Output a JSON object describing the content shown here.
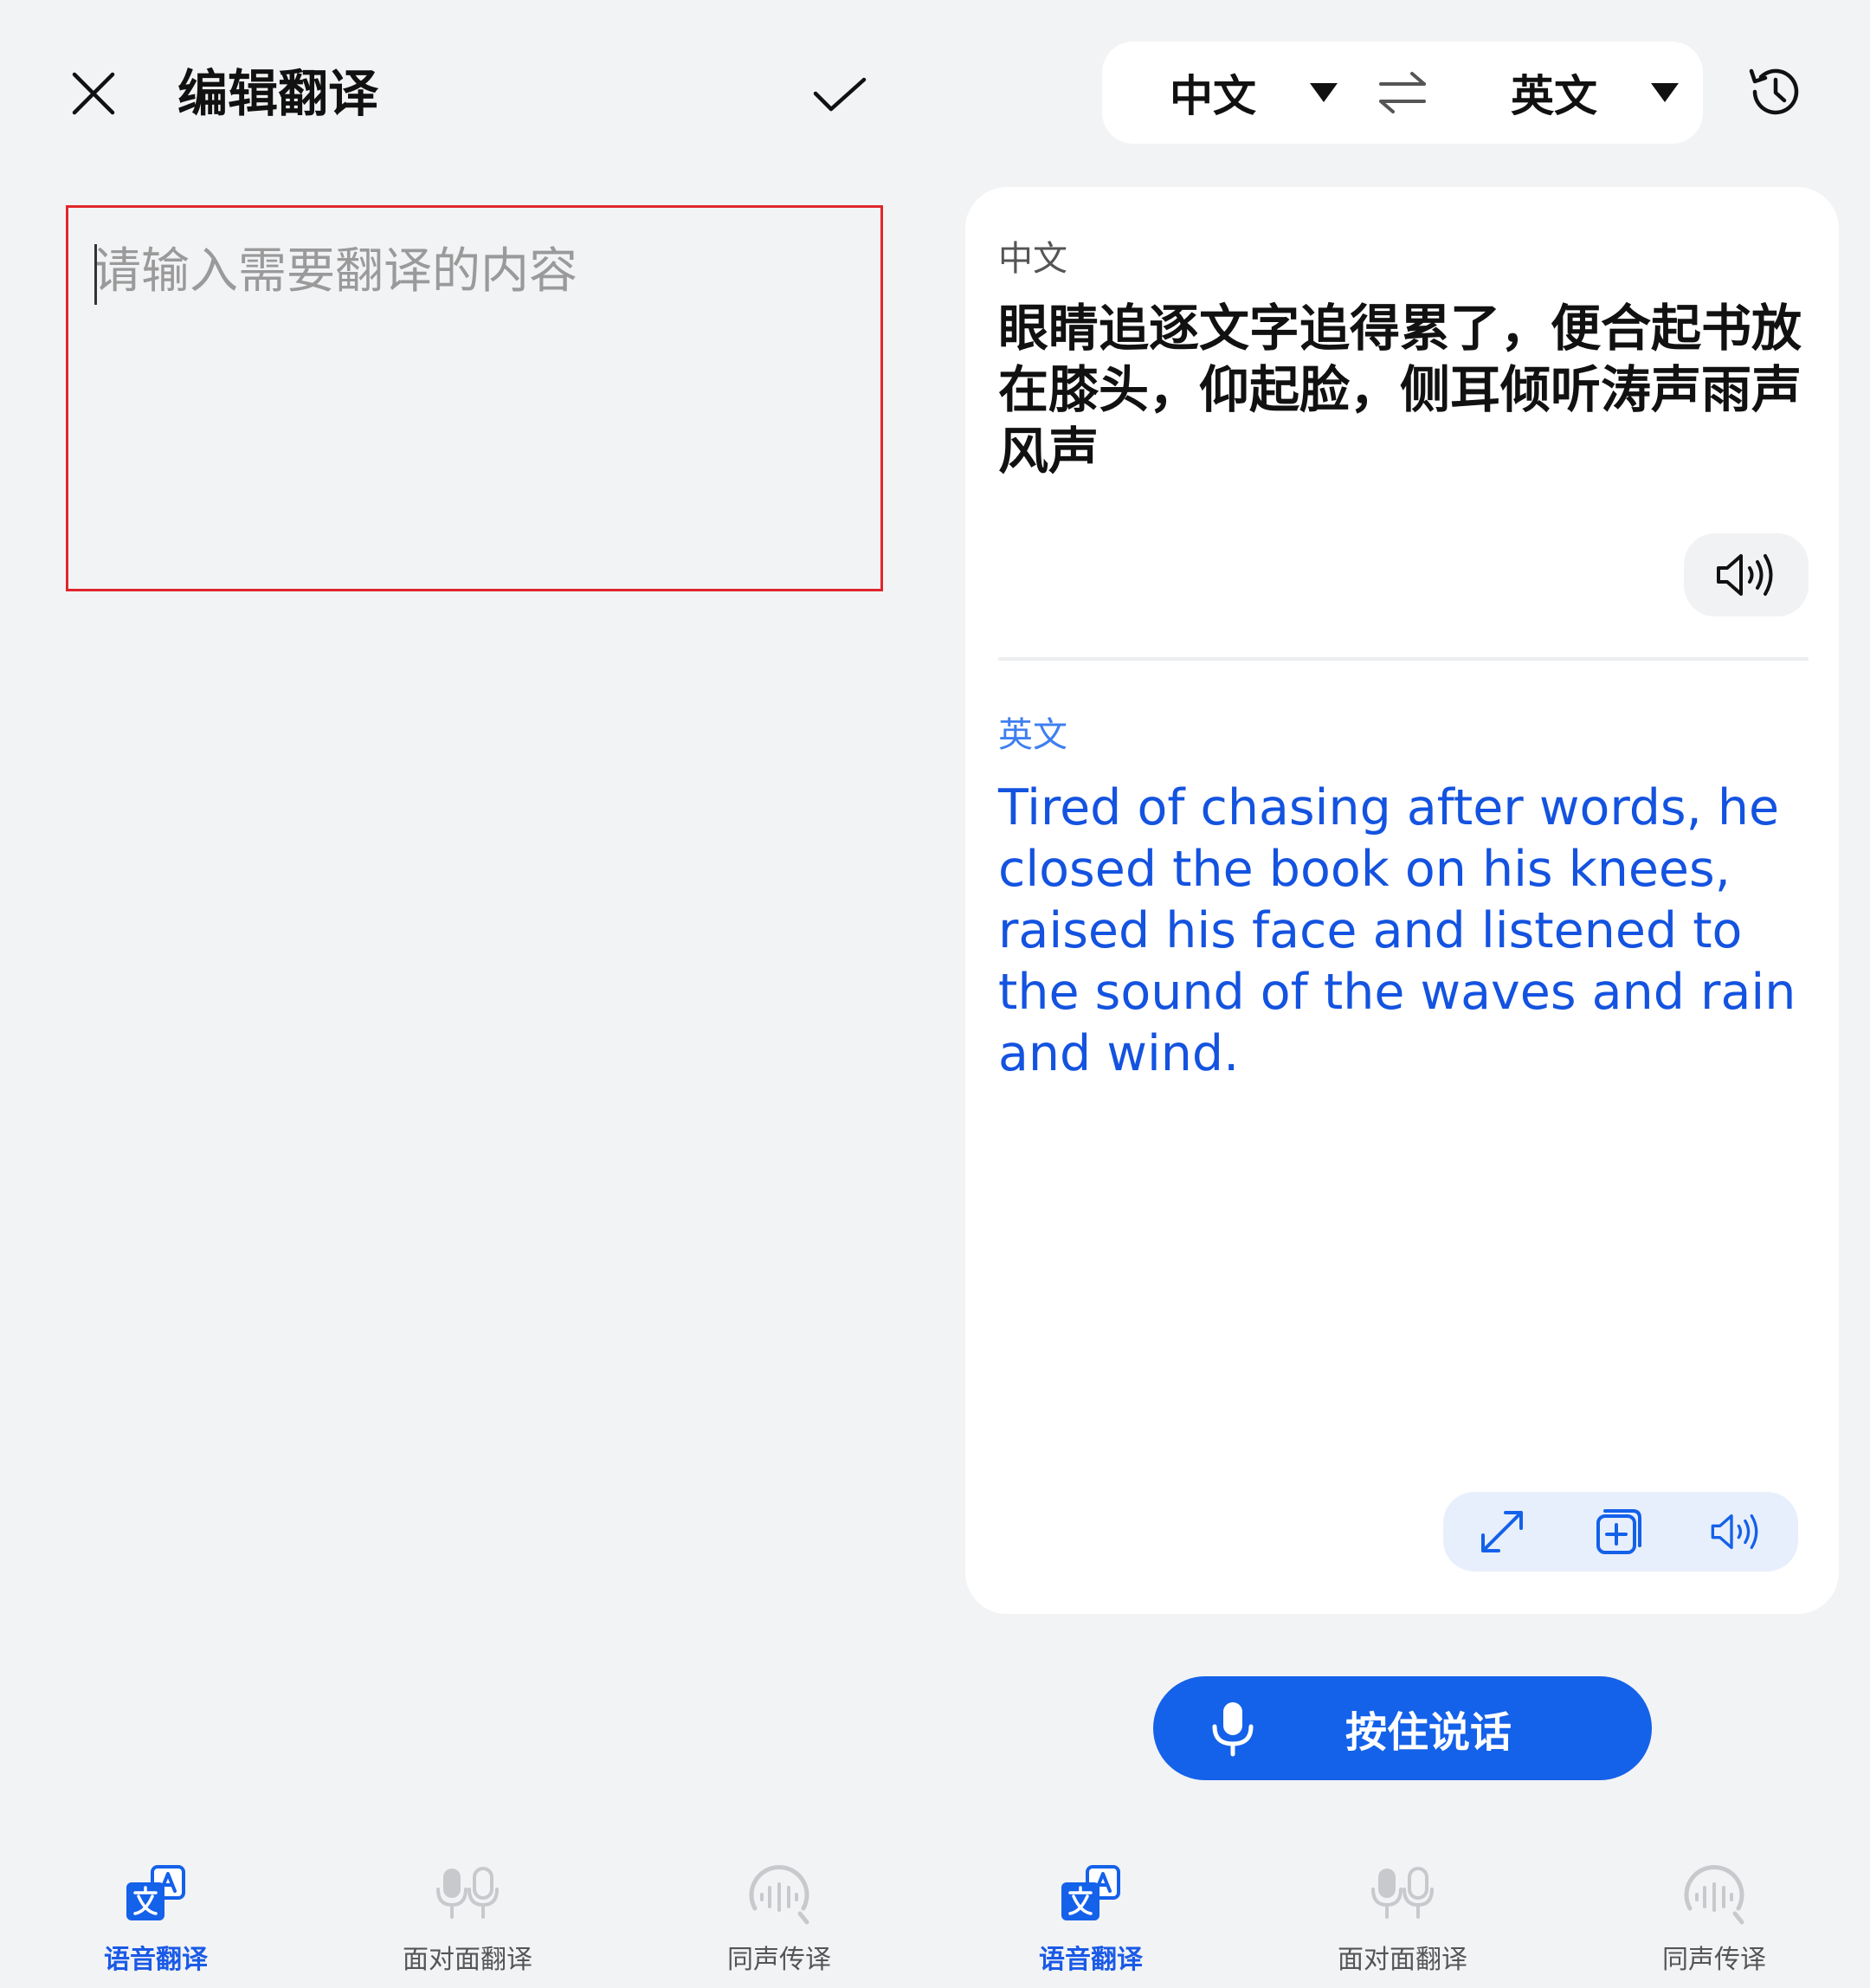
{
  "left_panel": {
    "title": "编辑翻译",
    "input": {
      "value": "",
      "placeholder": "请输入需要翻译的内容"
    }
  },
  "language_bar": {
    "source": "中文",
    "target": "英文"
  },
  "result": {
    "source_label": "中文",
    "source_text": "眼睛追逐文字追得累了，便合起书放在膝头，仰起脸，侧耳倾听涛声雨声风声",
    "target_label": "英文",
    "target_text": "Tired of chasing after words, he closed the book on his knees, raised his face and listened to the sound of the waves and rain and wind."
  },
  "push_to_talk": {
    "label": "按住说话"
  },
  "nav_left": [
    {
      "label": "语音翻译",
      "icon": "voice-translate-icon",
      "active": true
    },
    {
      "label": "面对面翻译",
      "icon": "face-to-face-mic-icon",
      "active": false
    },
    {
      "label": "同声传译",
      "icon": "simultaneous-interpretation-icon",
      "active": false
    }
  ],
  "nav_right": [
    {
      "label": "语音翻译",
      "icon": "voice-translate-icon",
      "active": true
    },
    {
      "label": "面对面翻译",
      "icon": "face-to-face-mic-icon",
      "active": false
    },
    {
      "label": "同声传译",
      "icon": "simultaneous-interpretation-icon",
      "active": false
    }
  ],
  "colors": {
    "accent": "#1461ea",
    "translation_text": "#1453e0",
    "highlight_border": "#e0262b",
    "background": "#f2f3f5"
  }
}
